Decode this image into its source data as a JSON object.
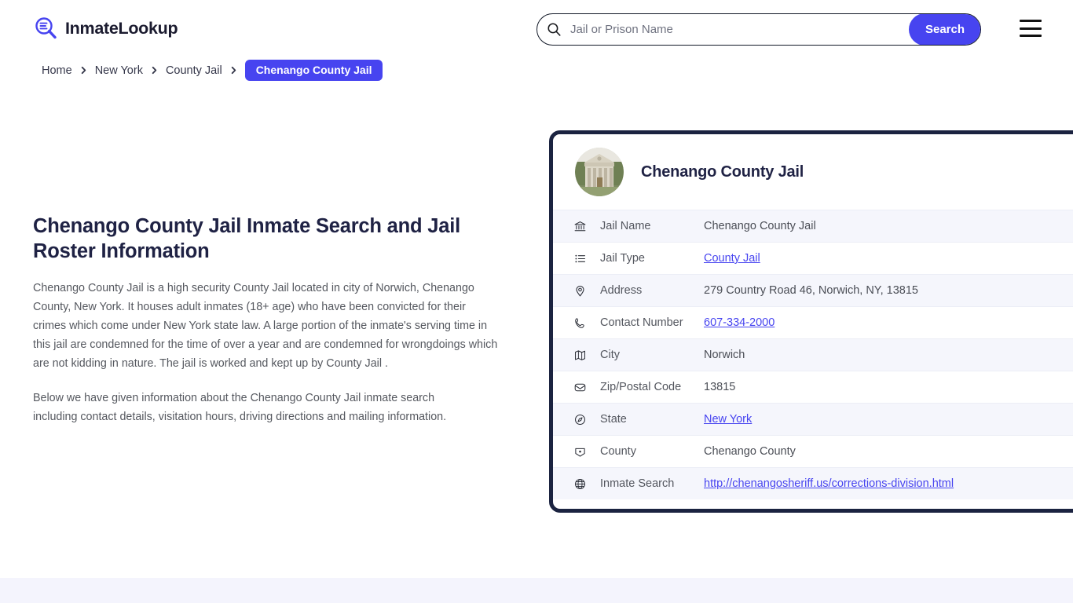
{
  "header": {
    "logo_text": "InmateLookup",
    "logo_icon": "magnifier-list-icon",
    "search": {
      "placeholder": "Jail or Prison Name",
      "value": "",
      "icon": "search-icon",
      "button_label": "Search",
      "button_color": "#4744f0"
    },
    "menu_icon": "hamburger-menu-icon"
  },
  "breadcrumb": {
    "items": [
      {
        "label": "Home",
        "current": false
      },
      {
        "label": "New York",
        "current": false
      },
      {
        "label": "County Jail",
        "current": false
      },
      {
        "label": "Chenango County Jail",
        "current": true
      }
    ],
    "separator": "›",
    "current_bg": "#4744f0"
  },
  "main": {
    "title": "Chenango County Jail Inmate Search and Jail Roster Information",
    "paragraphs": [
      "Chenango County Jail is a high security County Jail located in city of Norwich, Chenango County, New York. It houses adult inmates (18+ age) who have been convicted for their crimes which come under New York state law. A large portion of the inmate's serving time in this jail are condemned for the time of over a year and are condemned for wrongdoings which are not kidding in nature. The jail is worked and kept up by County Jail .",
      "Below we have given information about the Chenango County Jail inmate search including contact details, visitation hours, driving directions and mailing information."
    ]
  },
  "card": {
    "avatar_icon": "courthouse-photo",
    "title": "Chenango County Jail",
    "border_color": "#1b2340",
    "rows": [
      {
        "icon": "bank-icon",
        "label": "Jail Name",
        "value": "Chenango County Jail",
        "link": false
      },
      {
        "icon": "list-icon",
        "label": "Jail Type",
        "value": "County Jail",
        "link": true
      },
      {
        "icon": "map-pin-icon",
        "label": "Address",
        "value": "279 Country Road 46, Norwich, NY, 13815",
        "link": false
      },
      {
        "icon": "phone-icon",
        "label": "Contact Number",
        "value": "607-334-2000",
        "link": true
      },
      {
        "icon": "map-icon",
        "label": "City",
        "value": "Norwich",
        "link": false
      },
      {
        "icon": "envelope-icon",
        "label": "Zip/Postal Code",
        "value": "13815",
        "link": false
      },
      {
        "icon": "compass-icon",
        "label": "State",
        "value": "New York",
        "link": true
      },
      {
        "icon": "county-icon",
        "label": "County",
        "value": "Chenango County",
        "link": false
      },
      {
        "icon": "globe-icon",
        "label": "Inmate Search",
        "value": "http://chenangosheriff.us/corrections-division.html",
        "link": true
      }
    ]
  },
  "footer": {
    "band_color": "#f4f4fd"
  }
}
